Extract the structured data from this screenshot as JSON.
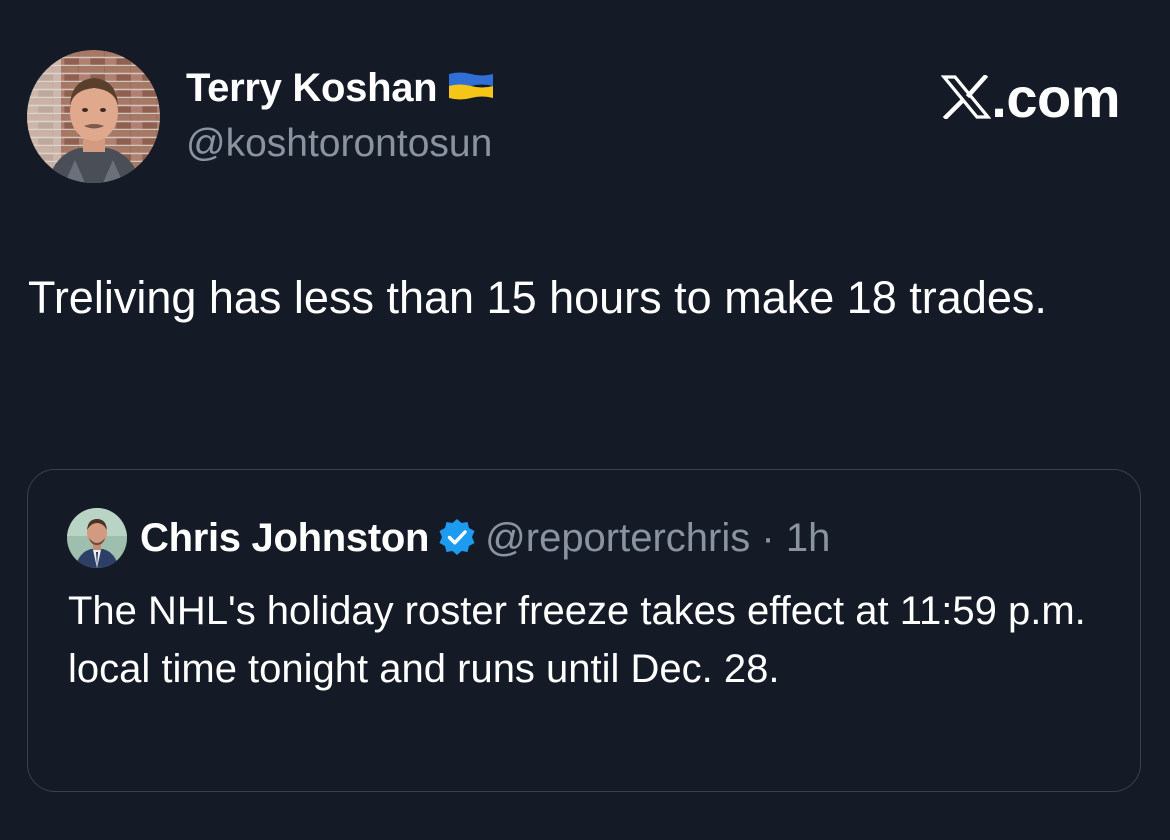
{
  "post": {
    "author": {
      "display_name": "Terry Koshan",
      "handle": "@koshtorontosun",
      "flag_icon": "ukraine-flag-icon"
    },
    "brand": ".com",
    "text": "Treliving has less than 15 hours to make 18 trades."
  },
  "quoted_post": {
    "author": {
      "display_name": "Chris Johnston",
      "handle": "@reporterchris",
      "verified_icon": "verified-badge-icon"
    },
    "separator": "·",
    "time": "1h",
    "text": "The NHL's holiday roster freeze takes effect at 11:59 p.m. local time tonight and runs until Dec. 28."
  },
  "colors": {
    "background": "#151b26",
    "secondary_text": "#8a94a1",
    "verified_blue": "#1d9bf0",
    "card_border": "#39414e"
  }
}
